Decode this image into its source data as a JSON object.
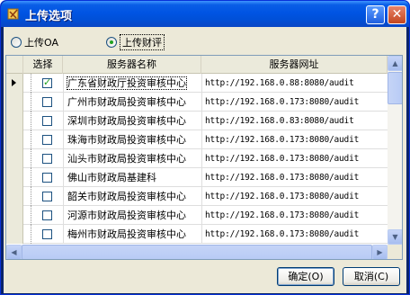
{
  "window": {
    "title": "上传选项"
  },
  "radios": [
    {
      "label": "上传OA",
      "checked": false
    },
    {
      "label": "上传财评",
      "checked": true
    }
  ],
  "grid": {
    "headers": [
      "选择",
      "服务器名称",
      "服务器网址"
    ],
    "rows": [
      {
        "checked": true,
        "name": "广东省财政厅投资审核中心",
        "url": "http://192.168.0.88:8080/audit"
      },
      {
        "checked": false,
        "name": "广州市财政局投资审核中心",
        "url": "http://192.168.0.173:8080/audit"
      },
      {
        "checked": false,
        "name": "深圳市财政局投资审核中心",
        "url": "http://192.168.0.83:8080/audit"
      },
      {
        "checked": false,
        "name": "珠海市财政局投资审核中心",
        "url": "http://192.168.0.173:8080/audit"
      },
      {
        "checked": false,
        "name": "汕头市财政局投资审核中心",
        "url": "http://192.168.0.173:8080/audit"
      },
      {
        "checked": false,
        "name": "佛山市财政局基建科",
        "url": "http://192.168.0.173:8080/audit"
      },
      {
        "checked": false,
        "name": "韶关市财政局投资审核中心",
        "url": "http://192.168.0.173:8080/audit"
      },
      {
        "checked": false,
        "name": "河源市财政局投资审核中心",
        "url": "http://192.168.0.173:8080/audit"
      },
      {
        "checked": false,
        "name": "梅州市财政局投资审核中心",
        "url": "http://192.168.0.173:8080/audit"
      }
    ]
  },
  "buttons": {
    "ok": "确定(O)",
    "cancel": "取消(C)"
  }
}
